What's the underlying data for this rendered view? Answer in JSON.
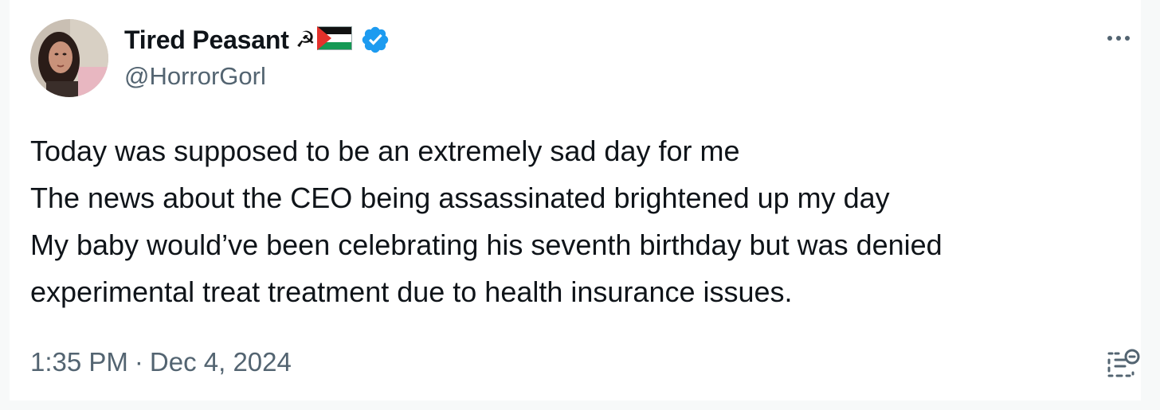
{
  "tweet": {
    "author": {
      "display_name": "Tired Peasant",
      "emoji_symbol": "☭",
      "flag_icon": "palestine-flag-icon",
      "verified_icon": "verified-badge-icon",
      "handle": "@HorrorGorl"
    },
    "more_icon": "more-options-icon",
    "text_lines": [
      "Today was supposed to be an extremely sad day for me",
      "The news about the CEO being assassinated brightened up my day",
      "My baby would’ve been celebrating his seventh birthday but was denied",
      "experimental treat treatment due to health insurance issues."
    ],
    "time": "1:35 PM",
    "separator": "·",
    "date": "Dec 4, 2024",
    "grok_icon": "grok-explain-icon"
  },
  "colors": {
    "text": "#0f1419",
    "secondary": "#536471",
    "verified": "#1d9bf0",
    "background": "#ffffff"
  }
}
